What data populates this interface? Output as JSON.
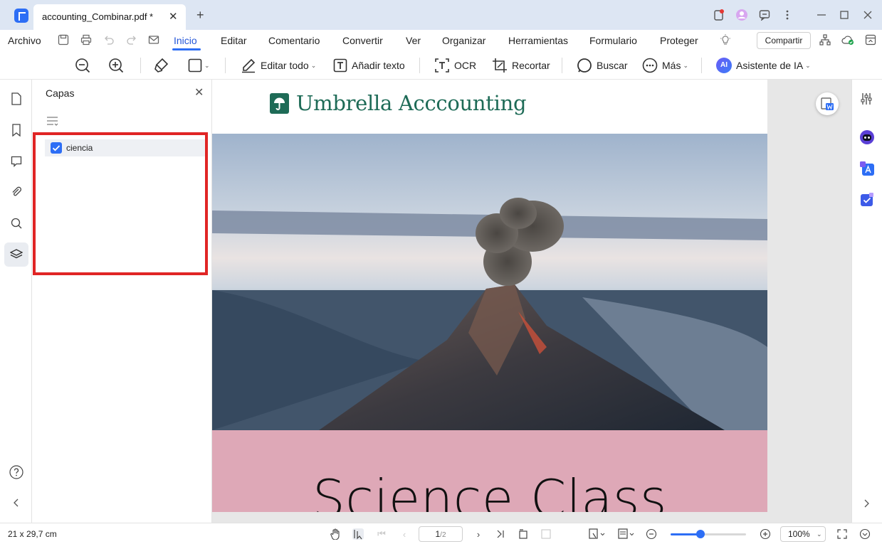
{
  "window": {
    "tab_title": "accounting_Combinar.pdf *",
    "tab_close": "✕",
    "new_tab": "+"
  },
  "menu": {
    "items": [
      "Archivo",
      "Inicio",
      "Editar",
      "Comentario",
      "Convertir",
      "Ver",
      "Organizar",
      "Herramientas",
      "Formulario",
      "Proteger"
    ],
    "active": "Inicio",
    "share_label": "Compartir"
  },
  "toolbar": {
    "edit_all": "Editar todo",
    "add_text": "Añadir texto",
    "ocr": "OCR",
    "crop": "Recortar",
    "search": "Buscar",
    "more": "Más",
    "ai_badge": "AI",
    "ai_assistant": "Asistente de IA"
  },
  "layers_panel": {
    "title": "Capas",
    "close": "✕",
    "layers": [
      {
        "name": "ciencia",
        "checked": true
      }
    ]
  },
  "document": {
    "brand_name": "Umbrella Acccounting",
    "heading": "Science Class"
  },
  "status": {
    "page_size": "21 x 29,7 cm",
    "current_page": "1",
    "total_pages": "/2",
    "zoom": "100%",
    "zoom_fraction": 0.4
  },
  "colors": {
    "accent": "#2d6ef5",
    "brand_green": "#1e6b57",
    "highlight_red": "#e02525",
    "band_pink": "#dea8b7"
  }
}
